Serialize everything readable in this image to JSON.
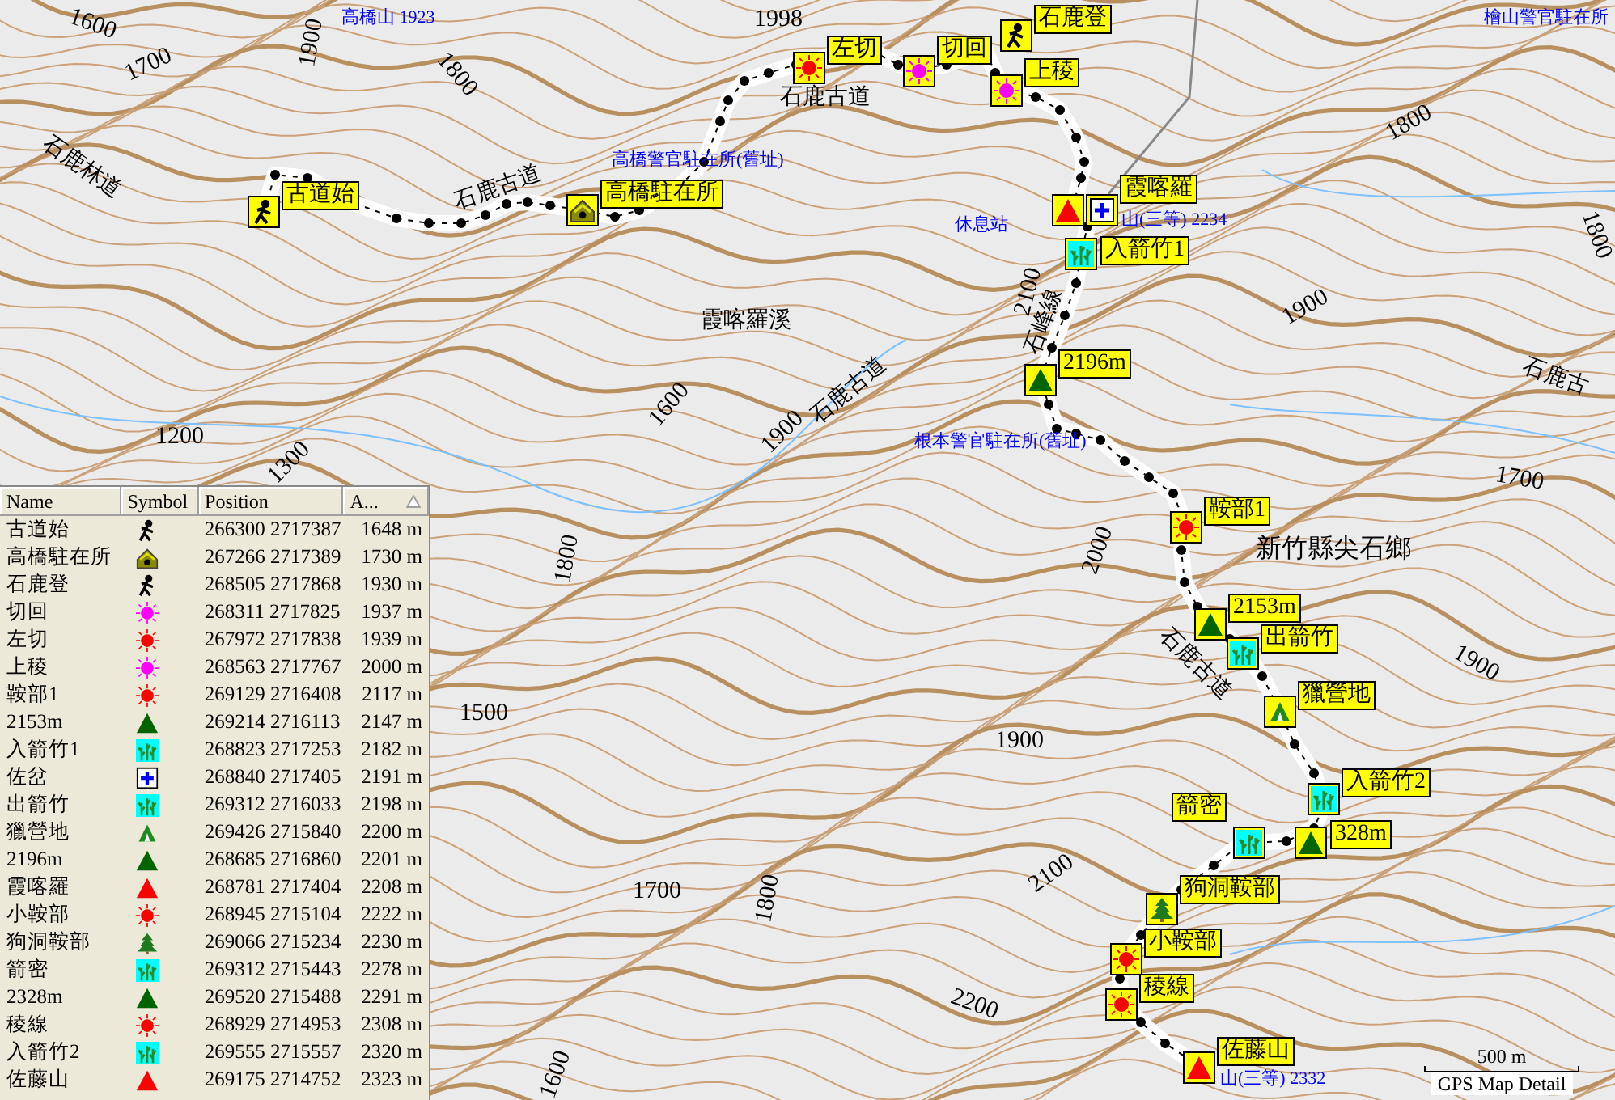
{
  "map": {
    "contour_labels": [
      "1600",
      "1700",
      "1900",
      "1800",
      "1998",
      "1200",
      "1300",
      "1600",
      "1900",
      "2100",
      "1800",
      "1800",
      "1900",
      "1700",
      "1800",
      "2000",
      "1900",
      "1900",
      "1500",
      "1700",
      "1800",
      "2100",
      "2200",
      "1600"
    ],
    "place_labels": [
      "高橋山 1923",
      "高橋警官駐在所(舊址)",
      "休息站",
      "山(三等) 2234",
      "根本警官駐在所(舊址)",
      "檜山警官駐在所",
      "山(三等) 2332"
    ],
    "area_labels": [
      "石鹿林道",
      "石鹿古道",
      "石鹿古道",
      "霞喀羅溪",
      "石鹿古道",
      "石峰線",
      "石鹿古",
      "新竹縣尖石鄉",
      "石鹿古道"
    ],
    "waypoints": [
      {
        "label": "古道始",
        "kind": "hiker"
      },
      {
        "label": "高橋駐在所",
        "kind": "hut"
      },
      {
        "label": "左切",
        "kind": "sun",
        "color": "#ff0000"
      },
      {
        "label": "切回",
        "kind": "sun",
        "color": "#ff00ff"
      },
      {
        "label": "石鹿登",
        "kind": "hiker"
      },
      {
        "label": "上稜",
        "kind": "sun",
        "color": "#ff00ff"
      },
      {
        "label": "霞喀羅",
        "kind": "summit",
        "color": "#ff0000"
      },
      {
        "kind": "cross"
      },
      {
        "label": "入箭竹1",
        "kind": "bamboo"
      },
      {
        "label": "2196m",
        "kind": "summit",
        "color": "#006400"
      },
      {
        "label": "鞍部1",
        "kind": "sun",
        "color": "#ff0000"
      },
      {
        "label": "2153m",
        "kind": "summit",
        "color": "#006400"
      },
      {
        "label": "出箭竹",
        "kind": "bamboo"
      },
      {
        "label": "獵營地",
        "kind": "camp"
      },
      {
        "label": "入箭竹2",
        "kind": "bamboo"
      },
      {
        "label": "328m",
        "kind": "summit",
        "color": "#006400"
      },
      {
        "label": "箭密",
        "kind": "bamboo"
      },
      {
        "label": "狗洞鞍部",
        "kind": "tree"
      },
      {
        "label": "小鞍部",
        "kind": "sun",
        "color": "#ff0000"
      },
      {
        "label": "稜線",
        "kind": "sun",
        "color": "#ff0000"
      },
      {
        "label": "佐藤山",
        "kind": "summit",
        "color": "#ff0000"
      }
    ],
    "scale": {
      "distance": "500 m",
      "caption": "GPS Map Detail"
    }
  },
  "table": {
    "columns": [
      {
        "label": "Name",
        "sorted": false
      },
      {
        "label": "Symbol",
        "sorted": false
      },
      {
        "label": "Position",
        "sorted": false
      },
      {
        "label": "A...",
        "sorted": true
      }
    ],
    "rows": [
      {
        "name": "古道始",
        "kind": "hiker",
        "position": "266300 2717387",
        "altitude": "1648 m"
      },
      {
        "name": "高橋駐在所",
        "kind": "hut",
        "position": "267266 2717389",
        "altitude": "1730 m"
      },
      {
        "name": "石鹿登",
        "kind": "hiker",
        "position": "268505 2717868",
        "altitude": "1930 m"
      },
      {
        "name": "切回",
        "kind": "sun",
        "color": "#ff00ff",
        "position": "268311 2717825",
        "altitude": "1937 m"
      },
      {
        "name": "左切",
        "kind": "sun",
        "color": "#ff0000",
        "position": "267972 2717838",
        "altitude": "1939 m"
      },
      {
        "name": "上稜",
        "kind": "sun",
        "color": "#ff00ff",
        "position": "268563 2717767",
        "altitude": "2000 m"
      },
      {
        "name": "鞍部1",
        "kind": "sun",
        "color": "#ff0000",
        "position": "269129 2716408",
        "altitude": "2117 m"
      },
      {
        "name": "2153m",
        "kind": "summit",
        "color": "#006400",
        "position": "269214 2716113",
        "altitude": "2147 m"
      },
      {
        "name": "入箭竹1",
        "kind": "bamboo",
        "position": "268823 2717253",
        "altitude": "2182 m"
      },
      {
        "name": "佐岔",
        "kind": "cross",
        "position": "268840 2717405",
        "altitude": "2191 m"
      },
      {
        "name": "出箭竹",
        "kind": "bamboo",
        "position": "269312 2716033",
        "altitude": "2198 m"
      },
      {
        "name": "獵營地",
        "kind": "camp",
        "position": "269426 2715840",
        "altitude": "2200 m"
      },
      {
        "name": "2196m",
        "kind": "summit",
        "color": "#006400",
        "position": "268685 2716860",
        "altitude": "2201 m"
      },
      {
        "name": "霞喀羅",
        "kind": "summit",
        "color": "#ff0000",
        "position": "268781 2717404",
        "altitude": "2208 m"
      },
      {
        "name": "小鞍部",
        "kind": "sun",
        "color": "#ff0000",
        "position": "268945 2715104",
        "altitude": "2222 m"
      },
      {
        "name": "狗洞鞍部",
        "kind": "tree",
        "position": "269066 2715234",
        "altitude": "2230 m"
      },
      {
        "name": "箭密",
        "kind": "bamboo",
        "position": "269312 2715443",
        "altitude": "2278 m"
      },
      {
        "name": "2328m",
        "kind": "summit",
        "color": "#006400",
        "position": "269520 2715488",
        "altitude": "2291 m"
      },
      {
        "name": "稜線",
        "kind": "sun",
        "color": "#ff0000",
        "position": "268929 2714953",
        "altitude": "2308 m"
      },
      {
        "name": "入箭竹2",
        "kind": "bamboo",
        "position": "269555 2715557",
        "altitude": "2320 m"
      },
      {
        "name": "佐藤山",
        "kind": "summit",
        "color": "#ff0000",
        "position": "269175 2714752",
        "altitude": "2323 m"
      }
    ]
  }
}
